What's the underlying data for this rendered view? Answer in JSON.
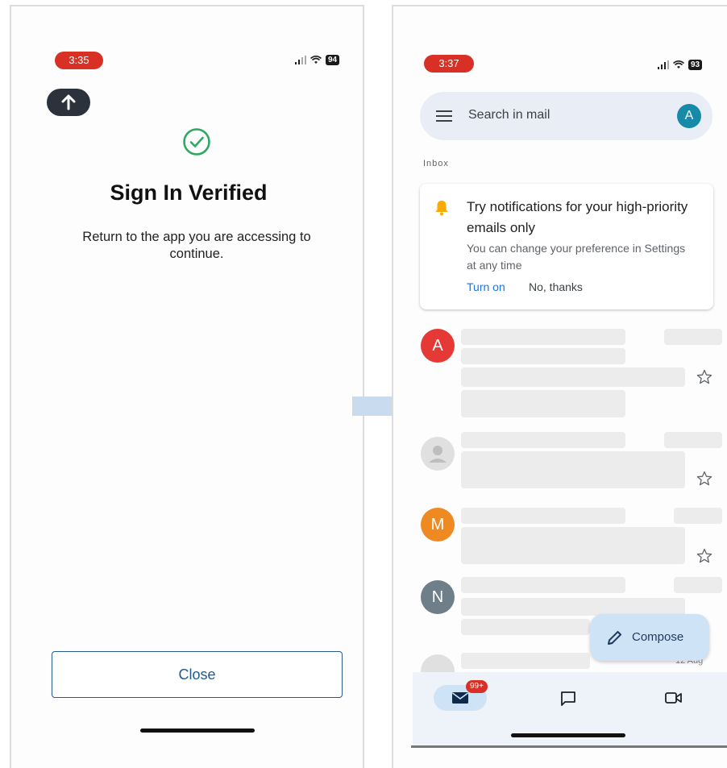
{
  "left_screen": {
    "status": {
      "time": "3:35",
      "battery": "94"
    },
    "title": "Sign In Verified",
    "message": "Return to the app you are accessing to continue.",
    "close_label": "Close"
  },
  "right_screen": {
    "status": {
      "time": "3:37",
      "battery": "93"
    },
    "search": {
      "placeholder": "Search in mail",
      "avatar_letter": "A"
    },
    "section_label": "Inbox",
    "notification": {
      "title": "Try notifications for your high-priority emails only",
      "body": "You can change your preference in Settings at any time",
      "primary_action": "Turn on",
      "secondary_action": "No, thanks"
    },
    "emails": [
      {
        "avatar_letter": "A",
        "avatar_color": "#e53935"
      },
      {
        "avatar_letter": "",
        "avatar_color": "#e0e0e0"
      },
      {
        "avatar_letter": "M",
        "avatar_color": "#ef8a23"
      },
      {
        "avatar_letter": "N",
        "avatar_color": "#6e7f8a"
      }
    ],
    "partial_date": "12 Aug",
    "compose_label": "Compose",
    "nav": {
      "mail_badge": "99+"
    }
  },
  "colors": {
    "status_pill": "#d93025",
    "check_green": "#2eaa63",
    "accent_blue": "#1a73e8",
    "compose_bg": "#cfe3f7",
    "arrow": "#c9dcef"
  },
  "icons": [
    "upload-arrow-icon",
    "check-circle-icon",
    "menu-icon",
    "bell-icon",
    "star-icon",
    "pencil-icon",
    "mail-icon",
    "chat-icon",
    "video-icon",
    "signal-icon",
    "wifi-icon"
  ]
}
